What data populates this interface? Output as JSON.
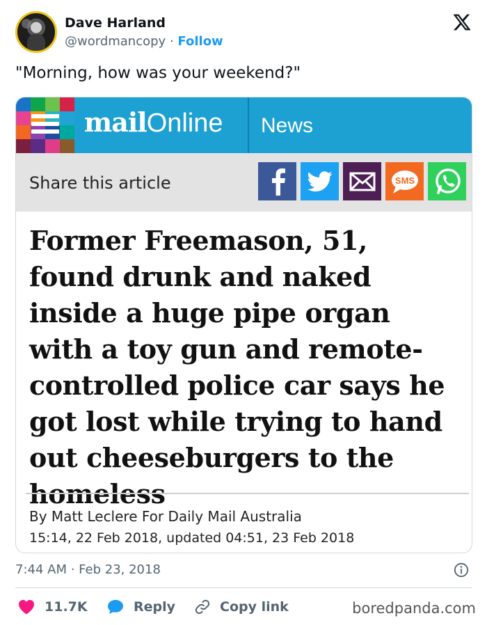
{
  "tweet": {
    "author_name": "Dave Harland",
    "author_handle": "@wordmancopy",
    "separator": "·",
    "follow_label": "Follow",
    "text": "\"Morning, how was your weekend?\"",
    "timestamp": "7:44 AM · Feb 23, 2018"
  },
  "card": {
    "brand_mail": "mail",
    "brand_online": "Online",
    "section": "News",
    "share_label": "Share this article",
    "share_buttons": [
      "facebook-icon",
      "twitter-icon",
      "email-icon",
      "sms-icon",
      "whatsapp-icon"
    ],
    "sms_text": "SMS",
    "headline": "Former Freemason, 51, found drunk and naked inside a huge pipe organ with a toy gun and remote-controlled police car says he got lost while trying to hand out cheeseburgers to the homeless",
    "byline": "By Matt Leclere For Daily Mail Australia",
    "dateline": "15:14, 22 Feb 2018, updated 04:51, 23 Feb 2018"
  },
  "actions": {
    "like_count": "11.7K",
    "reply_label": "Reply",
    "copy_link_label": "Copy link"
  },
  "watermark": "boredpanda.com",
  "colors": {
    "follow_blue": "#1d9bf0",
    "mail_bar": "#1da0d2",
    "like_pink": "#f91880",
    "reply_blue": "#1d9bf0"
  }
}
